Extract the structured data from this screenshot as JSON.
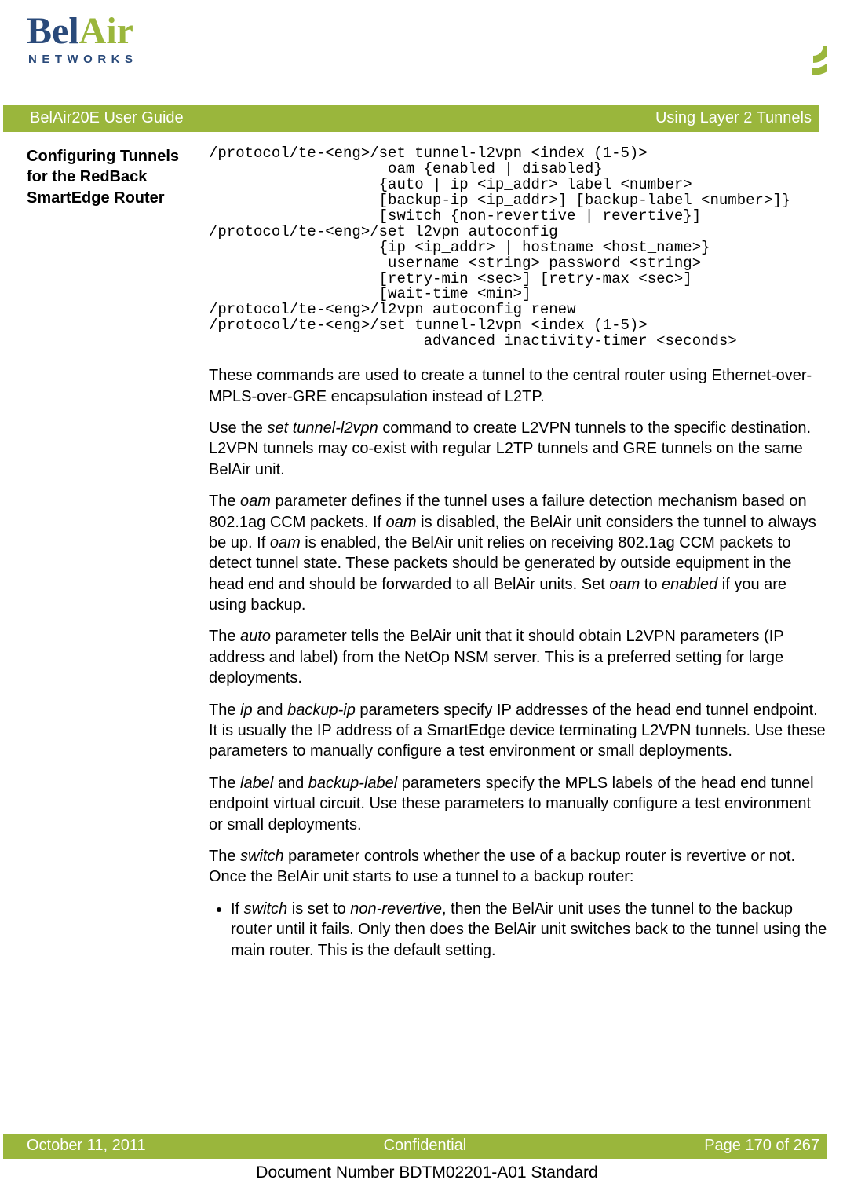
{
  "logo": {
    "word1": "Bel",
    "word2": "Air",
    "sub": "NETWORKS"
  },
  "header": {
    "left": "BelAir20E User Guide",
    "right": "Using Layer 2 Tunnels"
  },
  "side_heading": "Configuring Tunnels for the RedBack SmartEdge Router",
  "code_block": "/protocol/te-<eng>/set tunnel-l2vpn <index (1-5)>\n                    oam {enabled | disabled}\n                   {auto | ip <ip_addr> label <number>\n                   [backup-ip <ip_addr>] [backup-label <number>]}\n                   [switch {non-revertive | revertive}]\n/protocol/te-<eng>/set l2vpn autoconfig\n                   {ip <ip_addr> | hostname <host_name>}\n                    username <string> password <string>\n                   [retry-min <sec>] [retry-max <sec>]\n                   [wait-time <min>]\n/protocol/te-<eng>/l2vpn autoconfig renew\n/protocol/te-<eng>/set tunnel-l2vpn <index (1-5)>\n                        advanced inactivity-timer <seconds>",
  "p1": "These commands are used to create a tunnel to the central router using Ethernet-over-MPLS-over-GRE encapsulation instead of L2TP.",
  "p2a": "Use the ",
  "p2_em1": "set tunnel-l2vpn",
  "p2b": " command to create L2VPN tunnels to the specific destination. L2VPN tunnels may co-exist with regular L2TP tunnels and GRE tunnels on the same BelAir unit.",
  "p3a": "The ",
  "p3_em1": "oam",
  "p3b": " parameter defines if the tunnel uses a failure detection mechanism based on 802.1ag CCM packets. If ",
  "p3_em2": "oam",
  "p3c": " is disabled, the BelAir unit considers the tunnel to always be up. If ",
  "p3_em3": "oam",
  "p3d": " is enabled, the BelAir unit relies on receiving 802.1ag CCM packets to detect tunnel state. These packets should be generated by outside equipment in the head end and should be forwarded to all BelAir units. Set ",
  "p3_em4": "oam",
  "p3e": " to ",
  "p3_em5": "enabled",
  "p3f": " if you are using backup.",
  "p4a": "The ",
  "p4_em1": "auto",
  "p4b": " parameter tells the BelAir unit that it should obtain L2VPN parameters (IP address and label) from the NetOp NSM server. This is a preferred setting for large deployments.",
  "p5a": "The ",
  "p5_em1": "ip",
  "p5b": " and ",
  "p5_em2": "backup-ip",
  "p5c": " parameters specify IP addresses of the head end tunnel endpoint. It is usually the IP address of a SmartEdge device terminating L2VPN tunnels. Use these parameters to manually configure a test environment or small deployments.",
  "p6a": "The ",
  "p6_em1": "label",
  "p6b": " and ",
  "p6_em2": "backup-label",
  "p6c": " parameters specify the MPLS labels of the head end tunnel endpoint virtual circuit. Use these parameters to manually configure a test environment or small deployments.",
  "p7a": "The ",
  "p7_em1": "switch",
  "p7b": " parameter controls whether the use of a backup router is revertive or not. Once the BelAir unit starts to use a tunnel to a backup router:",
  "li1a": "If ",
  "li1_em1": "switch",
  "li1b": " is set to ",
  "li1_em2": "non-revertive",
  "li1c": ", then the BelAir unit uses the tunnel to the backup router until it fails. Only then does the BelAir unit switches back to the tunnel using the main router. This is the default setting.",
  "footer": {
    "date": "October 11, 2011",
    "conf": "Confidential",
    "page": "Page 170 of 267",
    "docnum": "Document Number BDTM02201-A01 Standard"
  }
}
